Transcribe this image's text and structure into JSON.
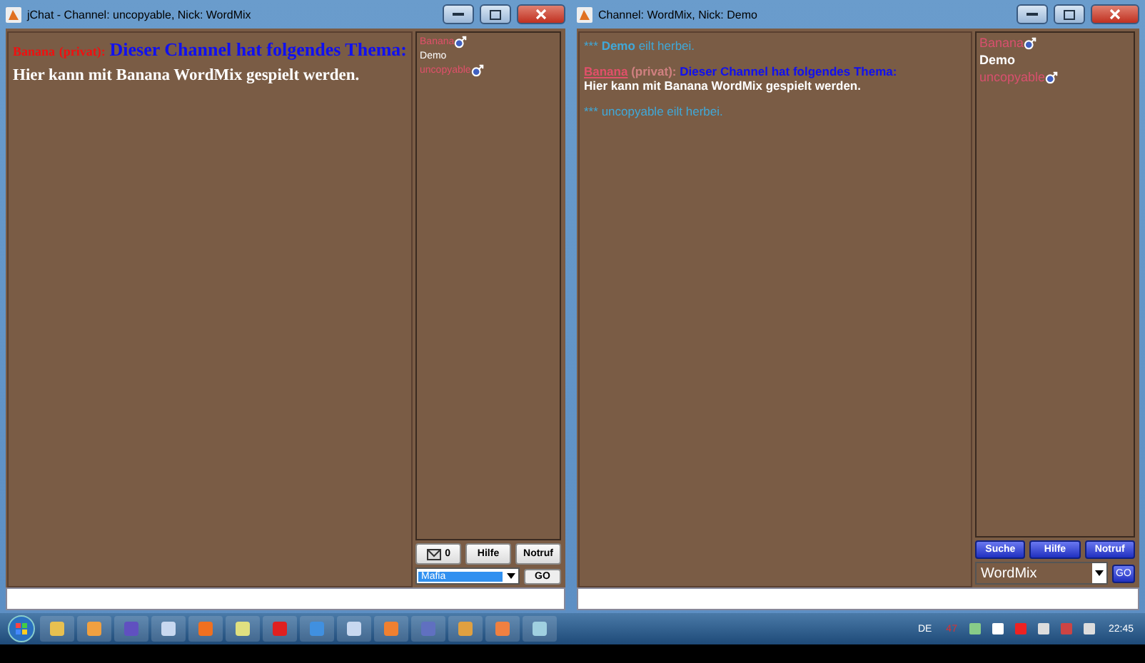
{
  "windows": [
    {
      "title": "jChat - Channel: uncopyable, Nick: WordMix",
      "messages": [
        {
          "kind": "topic",
          "sender": "Banana",
          "tag": "(privat):",
          "text": "Dieser Channel hat folgendes Thema:",
          "body": "Hier kann mit Banana WordMix gespielt werden."
        }
      ],
      "users": [
        {
          "name": "Banana",
          "color": "#e0506a",
          "male": true
        },
        {
          "name": "Demo",
          "color": "#ffffff",
          "male": false
        },
        {
          "name": "uncopyable",
          "color": "#e0506a",
          "male": true
        }
      ],
      "buttons": [
        {
          "kind": "mail",
          "label": "0"
        },
        {
          "kind": "text",
          "label": "Hilfe"
        },
        {
          "kind": "text",
          "label": "Notruf"
        }
      ],
      "combo": {
        "value": "Mafia",
        "selected": true
      },
      "go": "GO"
    },
    {
      "title": "Channel: WordMix,  Nick: Demo",
      "messages": [
        {
          "kind": "join",
          "prefix": "***",
          "nick": "Demo",
          "nick_bold": true,
          "text": "eilt herbei."
        },
        {
          "kind": "topic",
          "sender": "Banana",
          "tag": "(privat):",
          "text": "Dieser Channel hat folgendes Thema:",
          "body": "Hier kann mit Banana WordMix gespielt werden."
        },
        {
          "kind": "join",
          "prefix": "***",
          "nick": "uncopyable",
          "nick_bold": false,
          "text": "eilt herbei."
        }
      ],
      "users": [
        {
          "name": "Banana",
          "color": "#d8506e",
          "male": true
        },
        {
          "name": "Demo",
          "color": "#ffffff",
          "male": false
        },
        {
          "name": "uncopyable",
          "color": "#d8506e",
          "male": true
        }
      ],
      "buttons": [
        {
          "kind": "text",
          "label": "Suche"
        },
        {
          "kind": "text",
          "label": "Hilfe"
        },
        {
          "kind": "text",
          "label": "Notruf"
        }
      ],
      "combo": {
        "value": "WordMix",
        "selected": false
      },
      "go": "GO"
    }
  ],
  "taskbar": {
    "language": "DE",
    "badge": "47",
    "clock": "22:45"
  }
}
